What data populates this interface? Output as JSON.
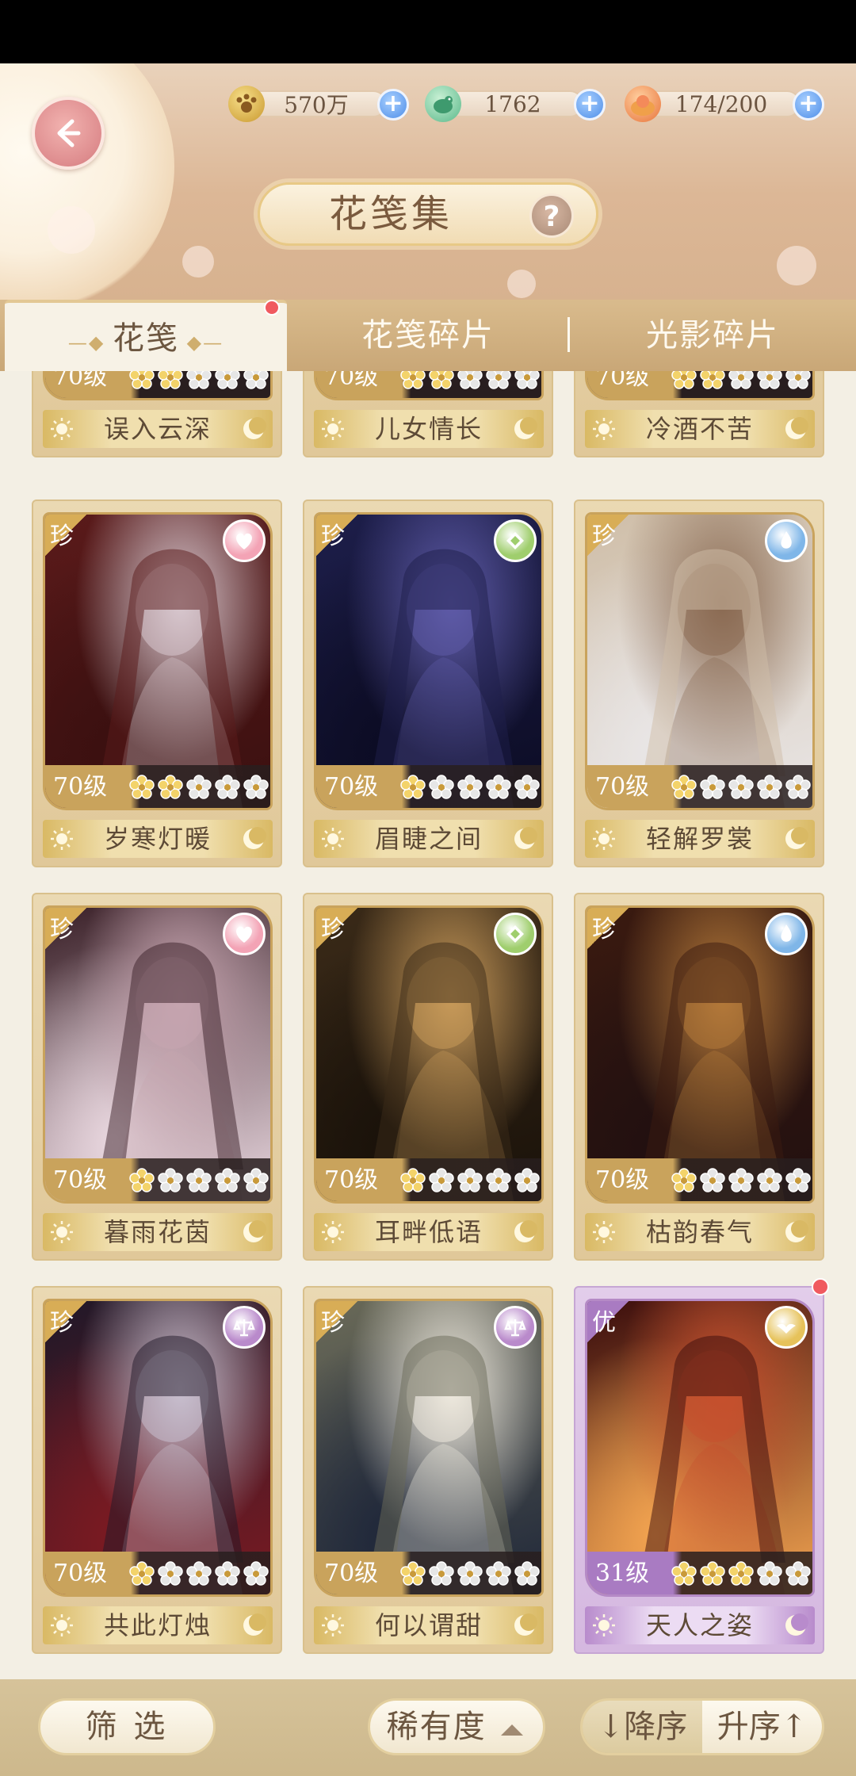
{
  "resources": [
    {
      "icon": "paw-coin-icon",
      "value": "570万"
    },
    {
      "icon": "jade-bird-icon",
      "value": "1762"
    },
    {
      "icon": "bun-stamina-icon",
      "value": "174/200"
    }
  ],
  "title": "花笺集",
  "tabs": [
    {
      "label": "花笺",
      "active": true,
      "badge": true
    },
    {
      "label": "花笺碎片",
      "active": false
    },
    {
      "label": "光影碎片",
      "active": false
    }
  ],
  "partial_row": [
    {
      "level": "70级",
      "name": "误入云深",
      "stars": 2
    },
    {
      "level": "70级",
      "name": "儿女情长",
      "stars": 2
    },
    {
      "level": "70级",
      "name": "冷酒不苦",
      "stars": 2
    }
  ],
  "cards": [
    {
      "rank": "珍",
      "level": "70级",
      "name": "岁寒灯暖",
      "stars": 2,
      "type_icon": "heart-icon",
      "type_color": "#f3a3b5",
      "palette": [
        "#5a1a1a",
        "#d8c8cf",
        "#3b1010"
      ]
    },
    {
      "rank": "珍",
      "level": "70级",
      "name": "眉睫之间",
      "stars": 1,
      "type_icon": "clover-icon",
      "type_color": "#9fce6d",
      "palette": [
        "#1d1e4a",
        "#5e5ba8",
        "#0c0c24"
      ]
    },
    {
      "rank": "珍",
      "level": "70级",
      "name": "轻解罗裳",
      "stars": 1,
      "type_icon": "flame-icon",
      "type_color": "#7fb6e8",
      "palette": [
        "#cfbea8",
        "#8a6a52",
        "#e9e6e6"
      ]
    },
    {
      "rank": "珍",
      "level": "70级",
      "name": "暮雨花茵",
      "stars": 1,
      "type_icon": "heart-icon",
      "type_color": "#f3a3b5",
      "palette": [
        "#3a2028",
        "#c7a5b0",
        "#e8d6de"
      ]
    },
    {
      "rank": "珍",
      "level": "70级",
      "name": "耳畔低语",
      "stars": 1,
      "type_icon": "clover-icon",
      "type_color": "#9fce6d",
      "palette": [
        "#3a2a18",
        "#c89a5a",
        "#1a120a"
      ]
    },
    {
      "rank": "珍",
      "level": "70级",
      "name": "枯韵春气",
      "stars": 1,
      "type_icon": "flame-icon",
      "type_color": "#7fb6e8",
      "palette": [
        "#3a1a10",
        "#b57a3a",
        "#221010"
      ]
    },
    {
      "rank": "珍",
      "level": "70级",
      "name": "共此灯烛",
      "stars": 1,
      "type_icon": "scale-icon",
      "type_color": "#b98acb",
      "palette": [
        "#201828",
        "#c9c0cf",
        "#7a1a22"
      ]
    },
    {
      "rank": "珍",
      "level": "70级",
      "name": "何以谓甜",
      "stars": 1,
      "type_icon": "scale-icon",
      "type_color": "#b98acb",
      "palette": [
        "#6a6a58",
        "#efeadf",
        "#20283a"
      ]
    },
    {
      "rank": "优",
      "level": "31级",
      "name": "天人之姿",
      "stars": 3,
      "type_icon": "bird-icon",
      "type_color": "#e6c25a",
      "palette": [
        "#3a0c0c",
        "#c7502e",
        "#f2a350"
      ],
      "purple": true,
      "badge": true
    }
  ],
  "bottom": {
    "filter_label": "筛 选",
    "sort_label": "稀有度",
    "desc_label": "↓降序",
    "asc_label": "升序↑"
  }
}
